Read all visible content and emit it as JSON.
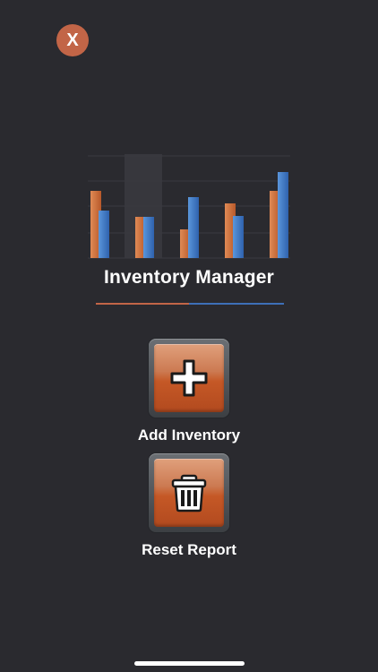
{
  "close_button": {
    "label": "X",
    "icon": "close-icon",
    "color": "#c26547"
  },
  "logo": {
    "icon": "bar-chart-logo-icon",
    "bar_groups": [
      {
        "orange": 0.75,
        "blue": 0.53
      },
      {
        "orange": 0.46,
        "blue": 0.46
      },
      {
        "orange": 0.32,
        "blue": 0.68
      },
      {
        "orange": 0.61,
        "blue": 0.47
      },
      {
        "orange": 0.75,
        "blue": 0.96
      }
    ],
    "colors": {
      "orange": "#d0743f",
      "blue": "#3f7cc8"
    }
  },
  "title": "Inventory Manager",
  "title_underline_colors": [
    "#c26547",
    "#3d6fb8"
  ],
  "actions": {
    "add": {
      "label": "Add Inventory",
      "icon": "plus-icon"
    },
    "reset": {
      "label": "Reset Report",
      "icon": "trash-icon"
    }
  },
  "theme": {
    "background": "#2a2a2f",
    "button_orange": "#c55826"
  }
}
